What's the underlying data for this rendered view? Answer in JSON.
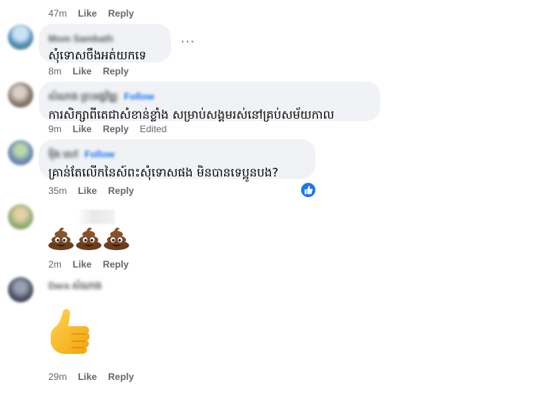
{
  "comments": [
    {
      "id": "c0",
      "actions": {
        "time": "47m",
        "like": "Like",
        "reply": "Reply"
      }
    },
    {
      "id": "c1",
      "author": "Mom Sambath",
      "text": "សុំទោសចឹងអត់យកទេ",
      "more_label": "···",
      "actions": {
        "time": "8m",
        "like": "Like",
        "reply": "Reply"
      }
    },
    {
      "id": "c2",
      "author": "សំណាង ព្រះអង្គវិឌ្ឍ",
      "follow": "Follow",
      "text": "ការសិក្សាពីតេជាសំខាន់ខ្លាំង សម្រាប់សង្គមរស់នៅគ្រប់សម័យកាល",
      "actions": {
        "time": "9m",
        "like": "Like",
        "reply": "Reply",
        "edited": "Edited"
      }
    },
    {
      "id": "c3",
      "author": "ម៉ិង សៅ",
      "follow": "Follow",
      "text": "គ្រាន់តែលើកនៃស៍ពះសុំទោសផង មិនបានទេប្អូនបង?",
      "actions": {
        "time": "35m",
        "like": "Like",
        "reply": "Reply"
      }
    },
    {
      "id": "c4",
      "emoji": "💩💩💩",
      "actions": {
        "time": "2m",
        "like": "Like",
        "reply": "Reply"
      }
    },
    {
      "id": "c5",
      "author": "Dara សំណាង",
      "emoji": "👍",
      "actions": {
        "time": "29m",
        "like": "Like",
        "reply": "Reply"
      }
    }
  ],
  "colors": {
    "accent": "#1877f2",
    "bubble": "#f0f2f5",
    "meta": "#65676b"
  }
}
